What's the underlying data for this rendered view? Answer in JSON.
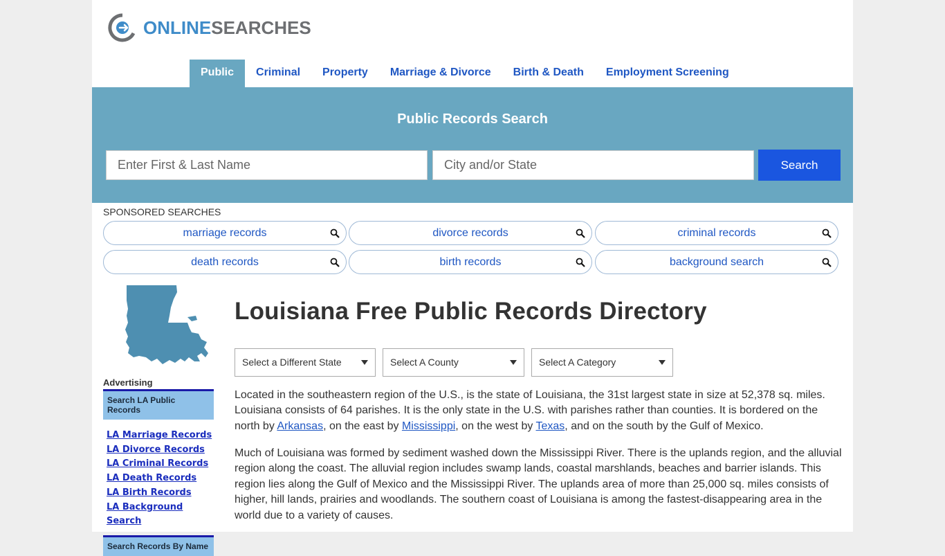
{
  "brand": {
    "word1": "ONLINE",
    "word2": "SEARCHES"
  },
  "nav": [
    {
      "label": "Public",
      "active": true
    },
    {
      "label": "Criminal"
    },
    {
      "label": "Property"
    },
    {
      "label": "Marriage & Divorce"
    },
    {
      "label": "Birth & Death"
    },
    {
      "label": "Employment Screening"
    }
  ],
  "hero": {
    "title": "Public Records Search",
    "name_placeholder": "Enter First & Last Name",
    "city_placeholder": "City and/or State",
    "search_label": "Search"
  },
  "sponsored": {
    "label": "SPONSORED SEARCHES",
    "items": [
      "marriage records",
      "divorce records",
      "criminal records",
      "death records",
      "birth records",
      "background search"
    ]
  },
  "sidebar": {
    "advertising": "Advertising",
    "head1": "Search LA Public Records",
    "links": [
      "LA Marriage Records",
      "LA Divorce Records",
      "LA Criminal Records",
      "LA Death Records",
      "LA Birth Records",
      "LA Background Search"
    ],
    "head2": "Search Records By Name"
  },
  "main": {
    "title": "Louisiana Free Public Records Directory",
    "selects": [
      "Select a Different State",
      "Select A County",
      "Select A Category"
    ],
    "p1_a": "Located in the southeastern region of the U.S., is the state of Louisiana, the 31st largest state in size at 52,378 sq. miles. Louisiana consists of 64 parishes. It is the only state in the U.S. with parishes rather than counties. It is bordered on the north by ",
    "link_arkansas": "Arkansas",
    "p1_b": ", on the east by ",
    "link_mississippi": "Mississippi",
    "p1_c": ", on the west by ",
    "link_texas": "Texas",
    "p1_d": ", and on the south by the Gulf of Mexico.",
    "p2": "Much of Louisiana was formed by sediment washed down the Mississippi River. There is the uplands region, and the alluvial region along the coast. The alluvial region includes swamp lands, coastal marshlands, beaches and barrier islands. This region lies along the Gulf of Mexico and the Mississippi River. The uplands area of more than 25,000 sq. miles consists of higher, hill lands, prairies and woodlands. The southern coast of Louisiana is among the fastest-disappearing area in the world due to a variety of causes."
  },
  "colors": {
    "brand_blue": "#3f8cc9",
    "hero_bg": "#69a7c1",
    "button_blue": "#1a56e0",
    "link_blue": "#1f57c3",
    "map_fill": "#4e8fb1"
  }
}
